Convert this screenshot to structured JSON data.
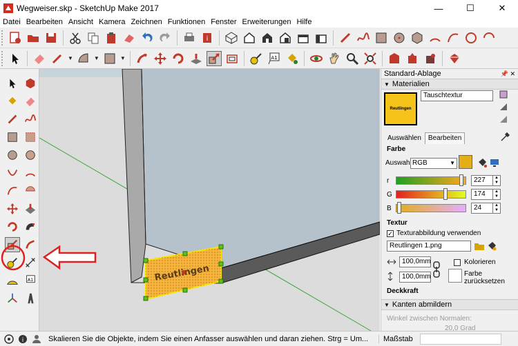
{
  "window": {
    "title": "Wegweiser.skp - SketchUp Make 2017",
    "min": "—",
    "max": "☐",
    "close": "✕"
  },
  "menu": [
    "Datei",
    "Bearbeiten",
    "Ansicht",
    "Kamera",
    "Zeichnen",
    "Funktionen",
    "Fenster",
    "Erweiterungen",
    "Hilfe"
  ],
  "model": {
    "sign_text": "Reutlingen"
  },
  "tray": {
    "title": "Standard-Ablage",
    "materials": {
      "header": "Materialien",
      "swatch_label": "Reutlingen",
      "name": "Tauschtextur",
      "tabs": [
        "Auswählen",
        "Bearbeiten"
      ],
      "active_tab": "Bearbeiten",
      "color_section": "Farbe",
      "picker_label": "Auswahl:",
      "picker_value": "RGB",
      "channels": [
        {
          "label": "r",
          "value": "227"
        },
        {
          "label": "G",
          "value": "174"
        },
        {
          "label": "B",
          "value": "24"
        }
      ],
      "accent_color": "#e3ae18",
      "texture_section": "Textur",
      "use_texture_label": "Texturabbildung verwenden",
      "use_texture_checked": true,
      "texture_file": "Reutlingen 1.png",
      "width": "100,0mm",
      "height": "100,0mm",
      "colorize_label": "Kolorieren",
      "reset_color_label": "Farbe\nzurücksetzen",
      "opacity_section": "Deckkraft"
    },
    "soften": {
      "header": "Kanten abmildern",
      "normals_label": "Winkel zwischen Normalen:",
      "normals_value": "20,0  Grad"
    }
  },
  "status": {
    "message": "Skalieren Sie die Objekte, indem Sie einen Anfasser auswählen und daran ziehen. Strg = Um...",
    "measure_label": "Maßstab"
  }
}
